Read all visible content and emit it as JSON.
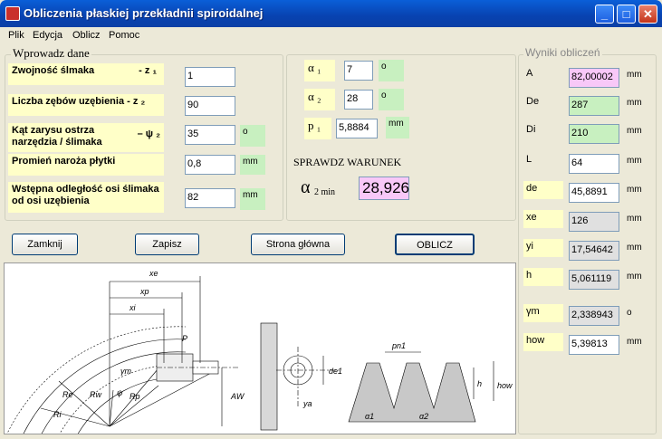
{
  "window": {
    "title": "Obliczenia płaskiej przekładnii spiroidalnej"
  },
  "menu": [
    {
      "label": "Plik",
      "accel": "P"
    },
    {
      "label": "Edycja",
      "accel": "E"
    },
    {
      "label": "Oblicz",
      "accel": "O"
    },
    {
      "label": "Pomoc",
      "accel": "P"
    }
  ],
  "input_group": {
    "title": "Wprowadz dane",
    "fields": [
      {
        "label": "Zwojność ślmaka",
        "symbol": "- z ₁",
        "value": "1",
        "unit": ""
      },
      {
        "label": "Liczba zębów  uzębienia - z ₂",
        "value": "90",
        "unit": ""
      },
      {
        "label": "Kąt zarysu ostrza narzędzia / ślimaka",
        "symbol": "– ψ ₂",
        "value": "35",
        "unit": "o"
      },
      {
        "label": "Promień naroża płytki",
        "value": "0,8",
        "unit": "mm"
      },
      {
        "label": "Wstępna odległość osi ślimaka od osi uzębienia",
        "value": "82",
        "unit": "mm"
      }
    ],
    "alpha1": {
      "label": "α ₁",
      "value": "7",
      "unit": "o"
    },
    "alpha2": {
      "label": "α ₂",
      "value": "28",
      "unit": "o"
    },
    "p1": {
      "label": "p ₁",
      "value": "5,8884",
      "unit": "mm"
    },
    "check": {
      "title": "SPRAWDZ WARUNEK",
      "symbol": "α",
      "sub": "2 min",
      "value": "28,926"
    }
  },
  "buttons": {
    "close": "Zamknij",
    "save": "Zapisz",
    "home": "Strona główna",
    "calc": "OBLICZ"
  },
  "results": {
    "title": "Wyniki obliczeń",
    "rows": [
      {
        "label": "A",
        "value": "82,00002",
        "unit": "mm",
        "bg": "#f8c8f8",
        "yellow": false
      },
      {
        "label": "De",
        "value": "287",
        "unit": "mm",
        "bg": "#c8f0c0",
        "yellow": false
      },
      {
        "label": "Di",
        "value": "210",
        "unit": "mm",
        "bg": "#c8f0c0",
        "yellow": false
      },
      {
        "label": "L",
        "value": "64",
        "unit": "mm",
        "bg": "#ffffff",
        "yellow": false
      },
      {
        "label": "de",
        "value": "45,8891",
        "unit": "mm",
        "bg": "#ffffff",
        "yellow": true
      },
      {
        "label": "xe",
        "value": "126",
        "unit": "mm",
        "bg": "#e0e0e0",
        "yellow": true
      },
      {
        "label": "yi",
        "value": "17,54642",
        "unit": "mm",
        "bg": "#e0e0e0",
        "yellow": true
      },
      {
        "label": "h",
        "value": "5,061119",
        "unit": "mm",
        "bg": "#e0e0e0",
        "yellow": true
      },
      {
        "label": "γm",
        "value": "2,338943",
        "unit": "o",
        "bg": "#e0e0e0",
        "yellow": true
      },
      {
        "label": "how",
        "value": "5,39813",
        "unit": "mm",
        "bg": "#ffffff",
        "yellow": true
      }
    ]
  },
  "diagram": {
    "labels": [
      "xe",
      "xp",
      "xi",
      "P",
      "γm",
      "Re",
      "Rw",
      "ψ",
      "Rp",
      "Ri",
      "AW",
      "de1",
      "ya",
      "pn1",
      "h",
      "how",
      "α1",
      "α2"
    ]
  }
}
